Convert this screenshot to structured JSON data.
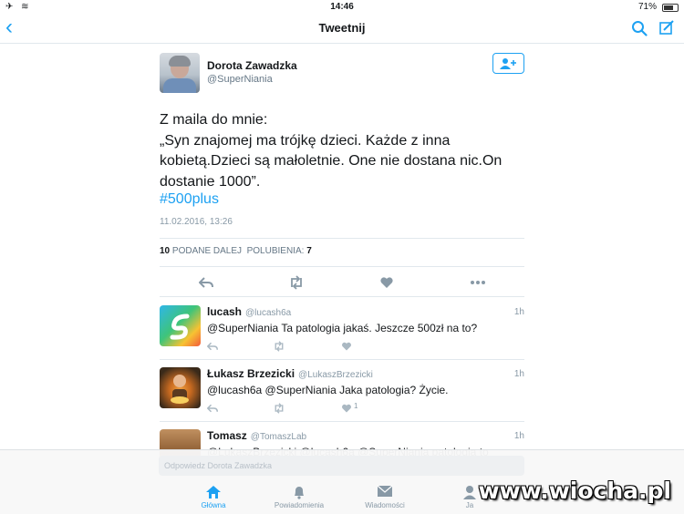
{
  "status_bar": {
    "carrier": "✈ ≋",
    "time": "14:46",
    "battery": "71%"
  },
  "nav": {
    "title": "Tweetnij"
  },
  "tweet": {
    "author": "Dorota Zawadzka",
    "handle": "@SuperNiania",
    "lines": [
      "Z maila do mnie:",
      "„Syn znajomej ma trójkę dzieci. Każde z inna",
      "kobietą.Dzieci są małoletnie. One nie dostana nic.On",
      "dostanie 1000”."
    ],
    "hashtag": "#500plus",
    "date": "11.02.2016, 13:26",
    "retweets_count": "10",
    "retweets_label": "PODANE DALEJ",
    "likes_label": "POLUBIENIA:",
    "likes_count": "7"
  },
  "replies": [
    {
      "name": "lucash",
      "handle": "@lucash6a",
      "time": "1h",
      "text": "@SuperNiania Ta patologia jakaś. Jeszcze 500zł na to?",
      "like_count": ""
    },
    {
      "name": "Łukasz Brzezicki",
      "handle": "@LukaszBrzezicki",
      "time": "1h",
      "text": "@lucash6a @SuperNiania Jaka patologia? Życie.",
      "like_count": "1"
    },
    {
      "name": "Tomasz",
      "handle": "@TomaszLab",
      "time": "1h",
      "text": "@LukaszBrzezicki @lucash6a @SuperNiania patologia to",
      "like_count": ""
    }
  ],
  "reply_box": {
    "placeholder": "Odpowiedz Dorota Zawadzka"
  },
  "tabs": [
    {
      "label": "Główna",
      "icon": "home-icon"
    },
    {
      "label": "Powiadomienia",
      "icon": "bell-icon"
    },
    {
      "label": "Wiadomości",
      "icon": "envelope-icon"
    },
    {
      "label": "Ja",
      "icon": "person-icon"
    }
  ],
  "watermark": {
    "text": "www.wiocha.pl"
  },
  "colors": {
    "accent": "#1da1f2",
    "text": "#14171a",
    "muted": "#8899a6"
  }
}
